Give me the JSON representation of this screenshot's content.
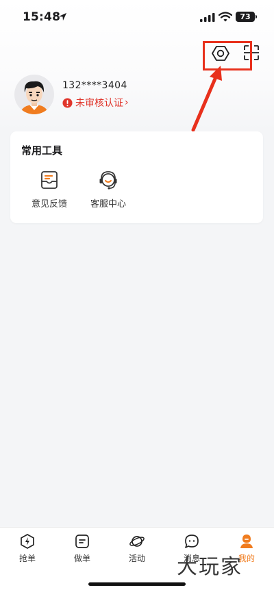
{
  "status_bar": {
    "time": "15:48",
    "battery": "73"
  },
  "header": {
    "settings_icon": "settings-hexagon-icon",
    "scan_icon": "scan-icon"
  },
  "profile": {
    "phone": "132****3404",
    "verify_text": "未审核认证",
    "verify_chevron": "›"
  },
  "tools": {
    "title": "常用工具",
    "items": [
      {
        "label": "意见反馈",
        "icon": "feedback-icon"
      },
      {
        "label": "客服中心",
        "icon": "customer-service-icon"
      }
    ]
  },
  "tabbar": {
    "items": [
      {
        "label": "抢单",
        "icon": "lightning-icon"
      },
      {
        "label": "做单",
        "icon": "document-icon"
      },
      {
        "label": "活动",
        "icon": "planet-icon"
      },
      {
        "label": "消息",
        "icon": "chat-icon"
      },
      {
        "label": "我的",
        "icon": "profile-icon",
        "active": true
      }
    ]
  },
  "watermark": "大玩家",
  "colors": {
    "accent": "#f07c1f",
    "alert": "#e0352b",
    "annotation": "#e8301c"
  }
}
